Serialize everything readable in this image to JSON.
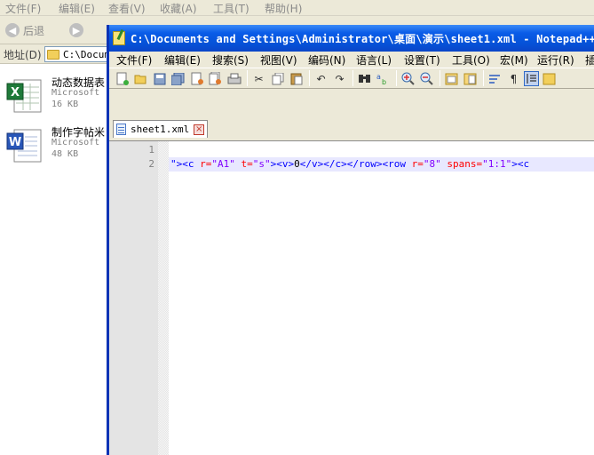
{
  "explorer": {
    "menu": [
      "文件(F)",
      "编辑(E)",
      "查看(V)",
      "收藏(A)",
      "工具(T)",
      "帮助(H)"
    ],
    "back_label": "后退",
    "address_label": "地址(D)",
    "address_value": "C:\\Docum",
    "files": [
      {
        "name": "动态数据表",
        "type": "Microsoft",
        "size": "16 KB"
      },
      {
        "name": "制作字帖米",
        "type": "Microsoft",
        "size": "48 KB"
      }
    ]
  },
  "notepad": {
    "title": "C:\\Documents and Settings\\Administrator\\桌面\\演示\\sheet1.xml - Notepad++",
    "menu": [
      "文件(F)",
      "编辑(E)",
      "搜索(S)",
      "视图(V)",
      "编码(N)",
      "语言(L)",
      "设置(T)",
      "工具(O)",
      "宏(M)",
      "运行(R)",
      "插件"
    ],
    "tab_label": "sheet1.xml",
    "line_numbers": [
      "1",
      "2"
    ],
    "line2_tokens": [
      {
        "t": "\">",
        "c": "tag"
      },
      {
        "t": "<c ",
        "c": "tag"
      },
      {
        "t": "r=",
        "c": "attr"
      },
      {
        "t": "\"A1\"",
        "c": "val"
      },
      {
        "t": " ",
        "c": "text"
      },
      {
        "t": "t=",
        "c": "attr"
      },
      {
        "t": "\"s\"",
        "c": "val"
      },
      {
        "t": "><v>",
        "c": "tag"
      },
      {
        "t": "0",
        "c": "text"
      },
      {
        "t": "</v></c></row><row ",
        "c": "tag"
      },
      {
        "t": "r=",
        "c": "attr"
      },
      {
        "t": "\"8\"",
        "c": "val"
      },
      {
        "t": " ",
        "c": "text"
      },
      {
        "t": "spans=",
        "c": "attr"
      },
      {
        "t": "\"1:1\"",
        "c": "val"
      },
      {
        "t": "><c",
        "c": "tag"
      }
    ]
  },
  "colors": {
    "title_bar": "#0a5ce8",
    "tag": "#0000ff",
    "attribute": "#ff0000",
    "value": "#8000ff",
    "current_line": "#e8e8ff"
  }
}
